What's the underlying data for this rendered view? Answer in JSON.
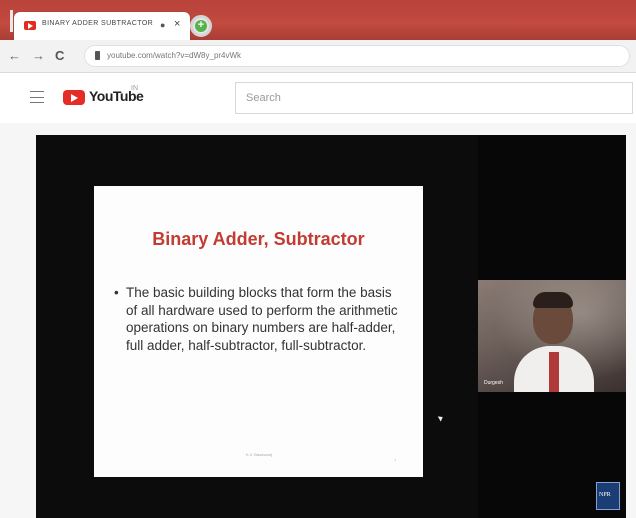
{
  "browser": {
    "tab_title": "BINARY ADDER SUBTRACTOR",
    "tab_dot": "●",
    "tab_close": "×",
    "new_tab": "+",
    "url": "youtube.com/watch?v=dW8y_pr4vWk",
    "nav": {
      "back": "←",
      "forward": "→",
      "reload": "C"
    }
  },
  "youtube": {
    "logo_text": "YouTube",
    "logo_superscript": "IN",
    "search_placeholder": "Search"
  },
  "video": {
    "slide_title": "Binary Adder, Subtractor",
    "slide_bullet_marker": "•",
    "slide_bullet": "The basic building blocks that form the basis of all hardware used to perform the arithmetic operations on binary numbers are half-adder, full adder, half-subtractor, full-subtractor.",
    "slide_footer": "K.V. Basavaraj",
    "slide_number": "1",
    "webcam_name": "Durgesh",
    "corner_logo": "NPR"
  },
  "colors": {
    "accent": "#c33b32",
    "tab_bar": "#c24a3f",
    "youtube_red": "#e52d27"
  }
}
